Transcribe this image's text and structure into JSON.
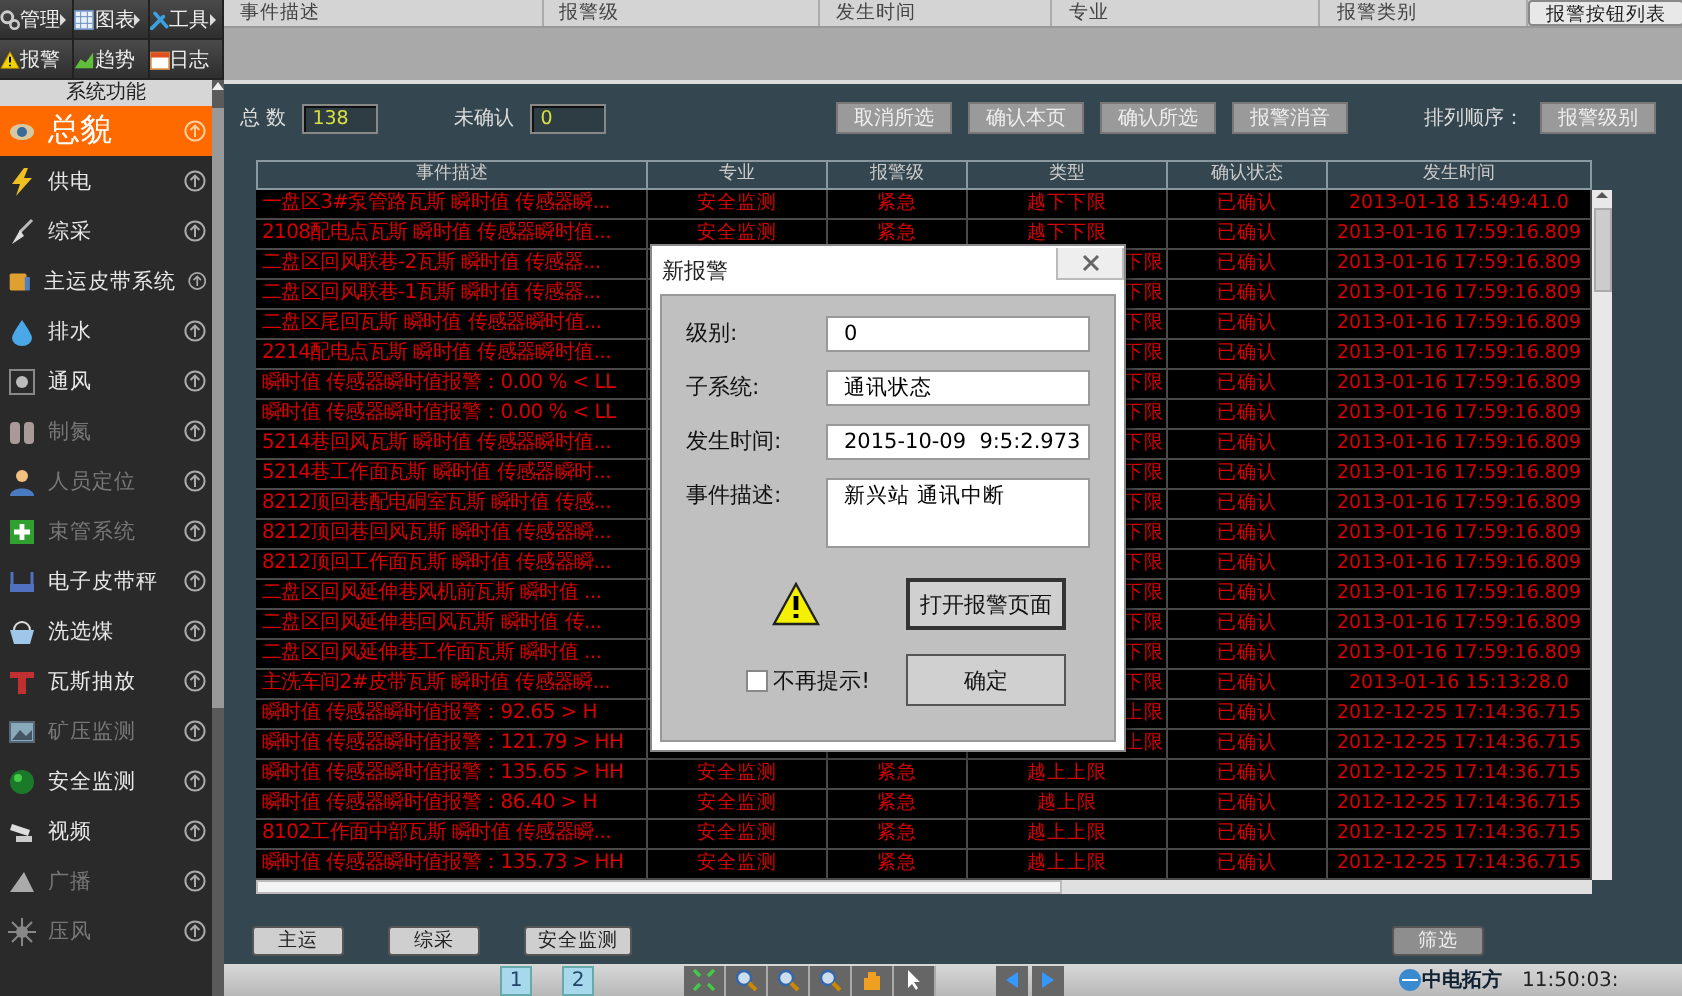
{
  "toolbar": [
    {
      "label": "管理",
      "submenu": true
    },
    {
      "label": "图表",
      "submenu": true
    },
    {
      "label": "工具",
      "submenu": true
    },
    {
      "label": "报警",
      "submenu": false
    },
    {
      "label": "趋势",
      "submenu": false
    },
    {
      "label": "日志",
      "submenu": false
    }
  ],
  "sidebar": {
    "title": "系统功能",
    "items": [
      {
        "label": "总貌",
        "selected": true,
        "disabled": false
      },
      {
        "label": "供电",
        "selected": false,
        "disabled": false
      },
      {
        "label": "综采",
        "selected": false,
        "disabled": false
      },
      {
        "label": "主运皮带系统",
        "selected": false,
        "disabled": false
      },
      {
        "label": "排水",
        "selected": false,
        "disabled": false
      },
      {
        "label": "通风",
        "selected": false,
        "disabled": false
      },
      {
        "label": "制氮",
        "selected": false,
        "disabled": true
      },
      {
        "label": "人员定位",
        "selected": false,
        "disabled": true
      },
      {
        "label": "束管系统",
        "selected": false,
        "disabled": true
      },
      {
        "label": "电子皮带秤",
        "selected": false,
        "disabled": false
      },
      {
        "label": "洗选煤",
        "selected": false,
        "disabled": false
      },
      {
        "label": "瓦斯抽放",
        "selected": false,
        "disabled": false
      },
      {
        "label": "矿压监测",
        "selected": false,
        "disabled": true
      },
      {
        "label": "安全监测",
        "selected": false,
        "disabled": false
      },
      {
        "label": "视频",
        "selected": false,
        "disabled": false
      },
      {
        "label": "广播",
        "selected": false,
        "disabled": true
      },
      {
        "label": "压风",
        "selected": false,
        "disabled": true
      }
    ]
  },
  "filter_header": {
    "columns": [
      "事件描述",
      "报警级",
      "发生时间",
      "专业",
      "报警类别"
    ],
    "button": "报警按钮列表"
  },
  "summary": {
    "total_label": "总 数",
    "total": "138",
    "unconfirmed_label": "未确认",
    "unconfirmed": "0"
  },
  "actions": [
    "取消所选",
    "确认本页",
    "确认所选",
    "报警消音"
  ],
  "sort": {
    "label": "排列顺序：",
    "button": "报警级别"
  },
  "table": {
    "columns": [
      "事件描述",
      "专业",
      "报警级",
      "类型",
      "确认状态",
      "发生时间"
    ],
    "rows": [
      {
        "description": "一盘区3#泵管路瓦斯 瞬时值 传感器瞬...",
        "major": "安全监测",
        "level": "紧急",
        "type": "越下下限",
        "status": "已确认",
        "time": "2013-01-18 15:49:41.0"
      },
      {
        "description": "2108配电点瓦斯 瞬时值 传感器瞬时值...",
        "major": "安全监测",
        "level": "紧急",
        "type": "越下下限",
        "status": "已确认",
        "time": "2013-01-16 17:59:16.809"
      },
      {
        "description": "二盘区回风联巷-2瓦斯 瞬时值 传感器...",
        "type": "下限",
        "status": "已确认",
        "time": "2013-01-16 17:59:16.809"
      },
      {
        "description": "二盘区回风联巷-1瓦斯 瞬时值 传感器...",
        "type": "下限",
        "status": "已确认",
        "time": "2013-01-16 17:59:16.809"
      },
      {
        "description": "二盘区尾回瓦斯 瞬时值 传感器瞬时值...",
        "type": "下限",
        "status": "已确认",
        "time": "2013-01-16 17:59:16.809"
      },
      {
        "description": "2214配电点瓦斯 瞬时值 传感器瞬时值...",
        "type": "下限",
        "status": "已确认",
        "time": "2013-01-16 17:59:16.809"
      },
      {
        "description": "瞬时值 传感器瞬时值报警：0.00 % < LL",
        "type": "下限",
        "status": "已确认",
        "time": "2013-01-16 17:59:16.809"
      },
      {
        "description": "瞬时值 传感器瞬时值报警：0.00 % < LL",
        "type": "下限",
        "status": "已确认",
        "time": "2013-01-16 17:59:16.809"
      },
      {
        "description": "5214巷回风瓦斯 瞬时值 传感器瞬时值...",
        "type": "下限",
        "status": "已确认",
        "time": "2013-01-16 17:59:16.809"
      },
      {
        "description": "5214巷工作面瓦斯 瞬时值 传感器瞬时...",
        "type": "下限",
        "status": "已确认",
        "time": "2013-01-16 17:59:16.809"
      },
      {
        "description": "8212顶回巷配电硐室瓦斯 瞬时值 传感...",
        "type": "下限",
        "status": "已确认",
        "time": "2013-01-16 17:59:16.809"
      },
      {
        "description": "8212顶回巷回风瓦斯 瞬时值 传感器瞬...",
        "type": "下限",
        "status": "已确认",
        "time": "2013-01-16 17:59:16.809"
      },
      {
        "description": "8212顶回工作面瓦斯 瞬时值 传感器瞬...",
        "type": "下限",
        "status": "已确认",
        "time": "2013-01-16 17:59:16.809"
      },
      {
        "description": "二盘区回风延伸巷风机前瓦斯 瞬时值 ...",
        "type": "下限",
        "status": "已确认",
        "time": "2013-01-16 17:59:16.809"
      },
      {
        "description": "二盘区回风延伸巷回风瓦斯 瞬时值 传...",
        "type": "下限",
        "status": "已确认",
        "time": "2013-01-16 17:59:16.809"
      },
      {
        "description": "二盘区回风延伸巷工作面瓦斯 瞬时值 ...",
        "type": "下限",
        "status": "已确认",
        "time": "2013-01-16 17:59:16.809"
      },
      {
        "description": "主洗车间2#皮带瓦斯 瞬时值 传感器瞬...",
        "type": "下限",
        "status": "已确认",
        "time": "2013-01-16 15:13:28.0"
      },
      {
        "description": "瞬时值 传感器瞬时值报警：92.65 > H",
        "type": "上限",
        "status": "已确认",
        "time": "2012-12-25 17:14:36.715"
      },
      {
        "description": "瞬时值 传感器瞬时值报警：121.79 > HH",
        "type": "上限",
        "status": "已确认",
        "time": "2012-12-25 17:14:36.715"
      },
      {
        "description": "瞬时值 传感器瞬时值报警：135.65 > HH",
        "major": "安全监测",
        "level": "紧急",
        "type": "越上上限",
        "status": "已确认",
        "time": "2012-12-25 17:14:36.715"
      },
      {
        "description": "瞬时值 传感器瞬时值报警：86.40 > H",
        "major": "安全监测",
        "level": "紧急",
        "type": "越上限",
        "status": "已确认",
        "time": "2012-12-25 17:14:36.715"
      },
      {
        "description": "8102工作面中部瓦斯 瞬时值 传感器瞬...",
        "major": "安全监测",
        "level": "紧急",
        "type": "越上上限",
        "status": "已确认",
        "time": "2012-12-25 17:14:36.715"
      },
      {
        "description": "瞬时值 传感器瞬时值报警：135.73 > HH",
        "major": "安全监测",
        "level": "紧急",
        "type": "越上上限",
        "status": "已确认",
        "time": "2012-12-25 17:14:36.715"
      }
    ]
  },
  "bottom_buttons": [
    "主运",
    "综采",
    "安全监测",
    "筛选"
  ],
  "status_bar": {
    "pages": [
      "1",
      "2"
    ],
    "brand": "中电拓方",
    "clock": "11:50:03:"
  },
  "dialog": {
    "title": "新报警",
    "fields": [
      {
        "label": "级别:",
        "value": "0",
        "kind": "line"
      },
      {
        "label": "子系统:",
        "value": "通讯状态",
        "kind": "line"
      },
      {
        "label": "发生时间:",
        "value": "2015-10-09  9:5:2.973",
        "kind": "line"
      },
      {
        "label": "事件描述:",
        "value": "新兴站 通讯中断",
        "kind": "area"
      }
    ],
    "open_button": "打开报警页面",
    "checkbox": {
      "label": "不再提示!",
      "checked": false
    },
    "ok_button": "确定"
  }
}
